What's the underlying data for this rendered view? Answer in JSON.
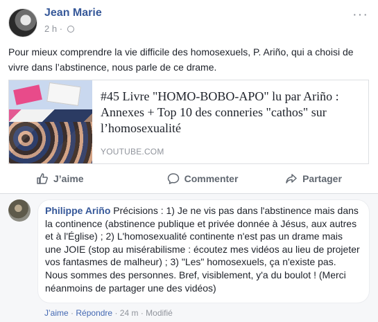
{
  "post": {
    "author": "Jean Marie",
    "time": "2 h",
    "separator": "·",
    "text": "Pour mieux comprendre la vie difficile des homosexuels, P. Ariño, qui a choisi de vivre dans l’abstinence, nous parle de ce drame.",
    "more_icon": "more-options-icon"
  },
  "link_card": {
    "title": "#45 Livre \"HOMO-BOBO-APO\" lu par Ariño : Annexes + Top 10 des conneries \"cathos\" sur l’homosexualité",
    "source": "YOUTUBE.COM"
  },
  "actions": {
    "like": "J’aime",
    "comment": "Commenter",
    "share": "Partager"
  },
  "comment": {
    "author": "Philippe Ariño",
    "text": "Précisions : 1) Je ne vis pas dans l'abstinence mais dans la continence (abstinence publique et privée donnée à Jésus, aux autres et à l'Église) ; 2) L'homosexualité continente n'est pas un drame mais une JOIE (stop au misérabilisme : écoutez mes vidéos au lieu de projeter vos fantasmes de malheur) ; 3) \"Les\" homosexuels, ça n'existe pas. Nous sommes des personnes. Bref, visiblement, y'a du boulot ! (Merci néanmoins de partager une des vidéos)",
    "like_link": "J’aime",
    "reply_link": "Répondre",
    "time": "24 m",
    "edited": "Modifié",
    "dot": "·"
  },
  "colors": {
    "link_blue": "#365899",
    "muted_gray": "#90949c",
    "action_gray": "#606770"
  }
}
